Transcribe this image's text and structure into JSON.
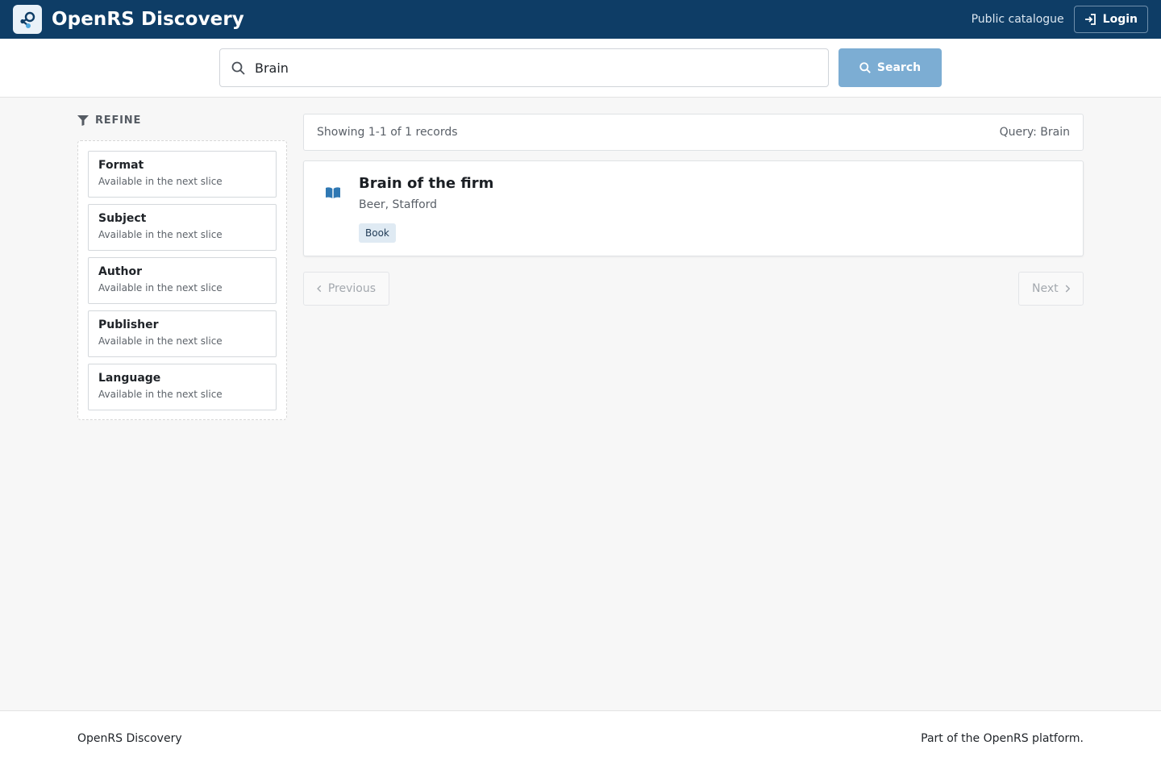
{
  "header": {
    "app_title": "OpenRS Discovery",
    "public_link": "Public catalogue",
    "login_label": "Login"
  },
  "search": {
    "value": "Brain",
    "button_label": "Search"
  },
  "sidebar": {
    "heading": "REFINE",
    "facets": [
      {
        "title": "Format",
        "note": "Available in the next slice"
      },
      {
        "title": "Subject",
        "note": "Available in the next slice"
      },
      {
        "title": "Author",
        "note": "Available in the next slice"
      },
      {
        "title": "Publisher",
        "note": "Available in the next slice"
      },
      {
        "title": "Language",
        "note": "Available in the next slice"
      }
    ]
  },
  "results": {
    "summary": "Showing 1-1 of 1 records",
    "query_label": "Query: Brain",
    "items": [
      {
        "title": "Brain of the firm",
        "author": "Beer, Stafford",
        "format": "Book"
      }
    ]
  },
  "pagination": {
    "previous_label": "Previous",
    "next_label": "Next"
  },
  "footer": {
    "left": "OpenRS Discovery",
    "right": "Part of the OpenRS platform."
  },
  "colors": {
    "header_bg": "#0e3d66",
    "search_button": "#7cadd3",
    "book_icon": "#2f78b3"
  }
}
